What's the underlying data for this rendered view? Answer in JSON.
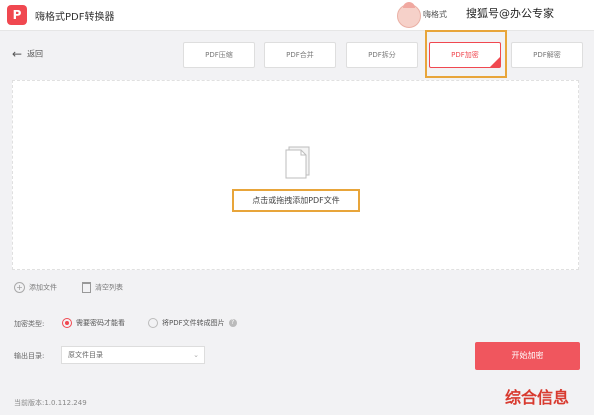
{
  "app": {
    "logo_letter": "P",
    "title": "嗨格式PDF转换器",
    "user_name": "嗨格式",
    "watermark": "搜狐号@办公专家"
  },
  "nav": {
    "back_label": "返回",
    "tabs": [
      {
        "label": "PDF压缩",
        "active": false
      },
      {
        "label": "PDF合并",
        "active": false
      },
      {
        "label": "PDF拆分",
        "active": false
      },
      {
        "label": "PDF加密",
        "active": true
      },
      {
        "label": "PDF解密",
        "active": false
      }
    ]
  },
  "dropzone": {
    "add_pdf_label": "点击或拖拽添加PDF文件"
  },
  "file_actions": {
    "add_file": "添加文件",
    "clear_list": "清空列表"
  },
  "options": {
    "encrypt_type_label": "加密类型:",
    "option_password": "需要密码才能看",
    "option_to_image": "将PDF文件转成图片",
    "output_dir_label": "输出目录:",
    "output_dir_value": "原文件目录"
  },
  "actions": {
    "start_label": "开始加密"
  },
  "footer": {
    "version": "当前版本:1.0.112.249",
    "corner_watermark": "综合信息"
  },
  "colors": {
    "accent": "#f04850",
    "highlight_border": "#e8a53a",
    "start_button": "#f0565e"
  }
}
